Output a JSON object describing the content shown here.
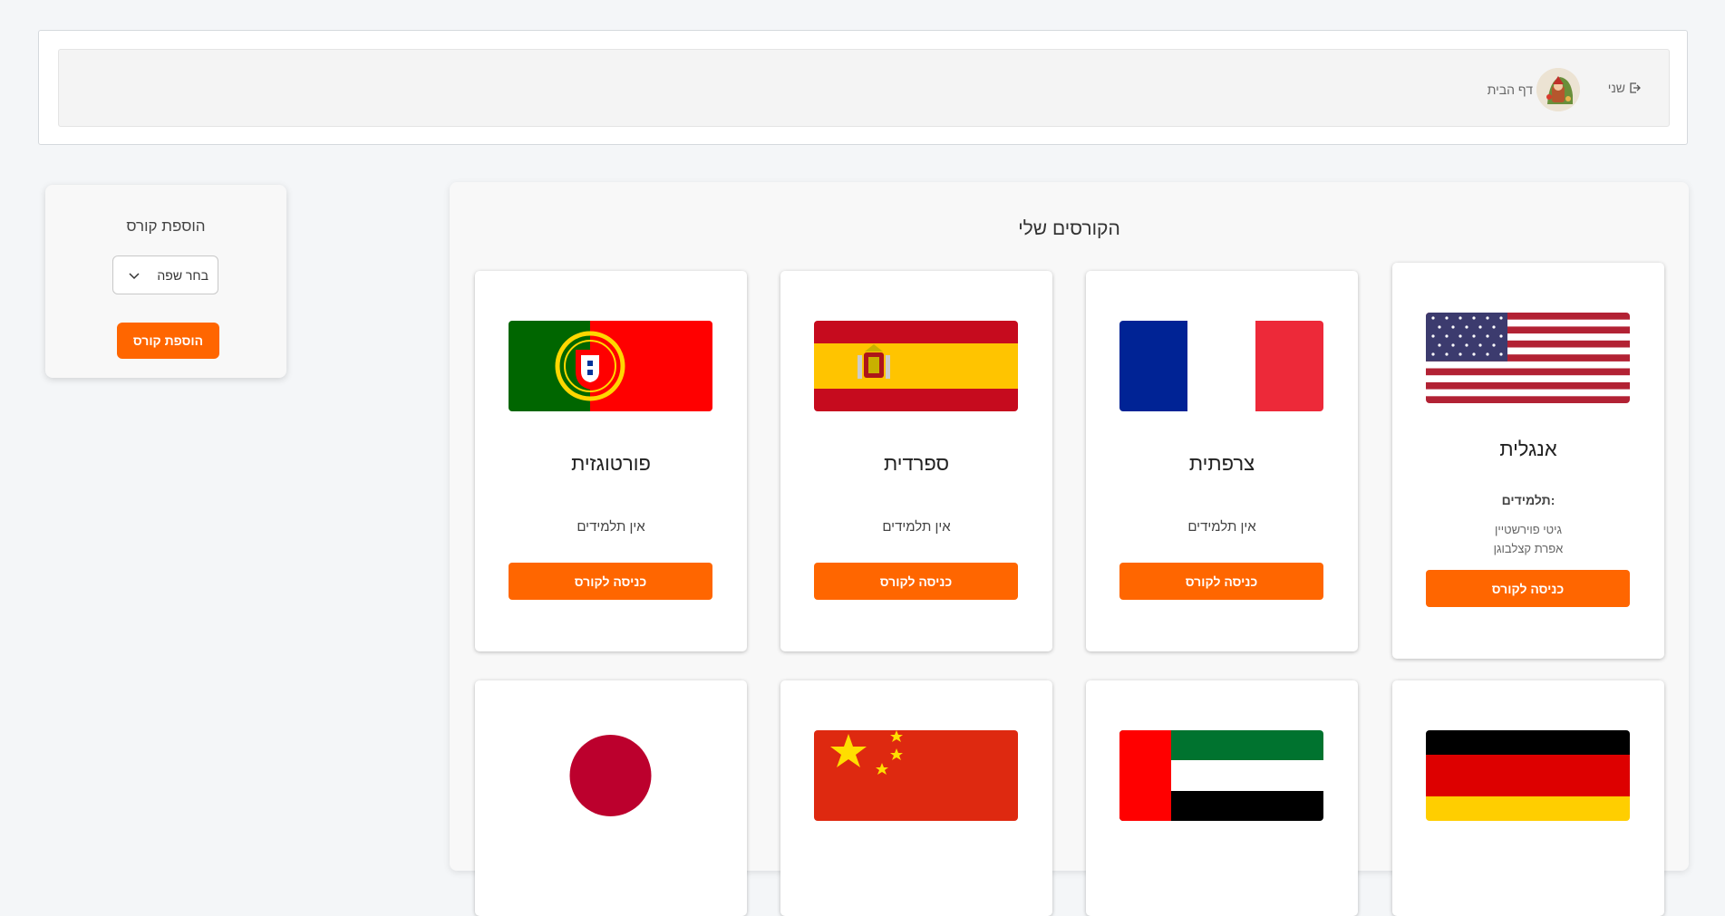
{
  "header": {
    "logout_label": "שני",
    "home_label": "דף הבית"
  },
  "add_course": {
    "title": "הוספת קורס",
    "select_value": "בחר שפה",
    "button_label": "הוספת קורס"
  },
  "courses": {
    "title": "הקורסים שלי",
    "cards": [
      {
        "name": "אנגלית",
        "flag_icon": "usa-flag-icon",
        "students_label": "תלמידים:",
        "students": [
          "גיטי פוירשטיין",
          "אפרת קצלבוגן"
        ],
        "button_label": "כניסה לקורס"
      },
      {
        "name": "צרפתית",
        "flag_icon": "france-flag-icon",
        "no_students": "אין תלמידים",
        "button_label": "כניסה לקורס"
      },
      {
        "name": "ספרדית",
        "flag_icon": "spain-flag-icon",
        "no_students": "אין תלמידים",
        "button_label": "כניסה לקורס"
      },
      {
        "name": "פורטוגזית",
        "flag_icon": "portugal-flag-icon",
        "no_students": "אין תלמידים",
        "button_label": "כניסה לקורס"
      },
      {
        "flag_icon": "germany-flag-icon"
      },
      {
        "flag_icon": "uae-flag-icon"
      },
      {
        "flag_icon": "china-flag-icon"
      },
      {
        "flag_icon": "japan-flag-icon"
      }
    ]
  },
  "colors": {
    "accent": "#ff6600",
    "background": "#f4f6f8"
  }
}
